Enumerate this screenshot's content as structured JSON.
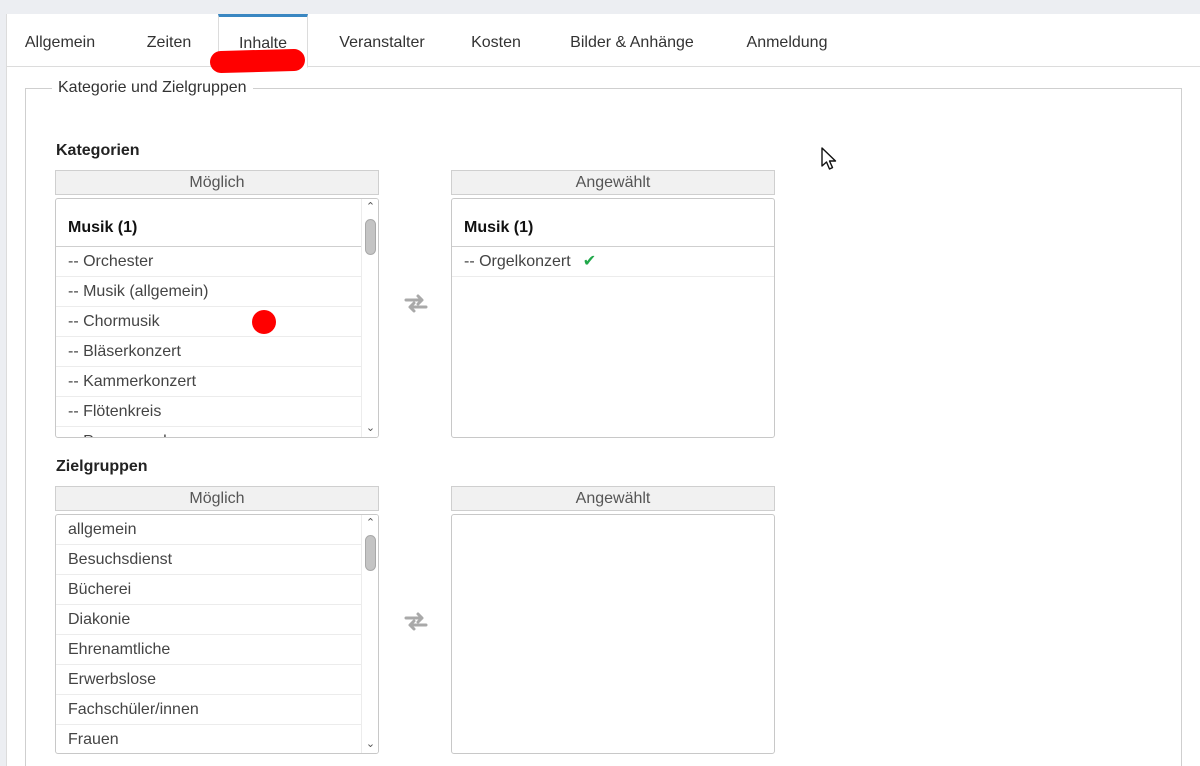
{
  "tabs": [
    {
      "label": "Allgemein"
    },
    {
      "label": "Zeiten"
    },
    {
      "label": "Inhalte"
    },
    {
      "label": "Veranstalter"
    },
    {
      "label": "Kosten"
    },
    {
      "label": "Bilder & Anhänge"
    },
    {
      "label": "Anmeldung"
    }
  ],
  "active_tab": "Inhalte",
  "fieldset": {
    "legend": "Kategorie und Zielgruppen"
  },
  "kategorien": {
    "title": "Kategorien",
    "possible_header": "Möglich",
    "selected_header": "Angewählt",
    "possible_group": "Musik (1)",
    "possible_items": [
      "-- Orchester",
      "-- Musik (allgemein)",
      "-- Chormusik",
      "-- Bläserkonzert",
      "-- Kammerkonzert",
      "-- Flötenkreis",
      "-- Posaunenchor"
    ],
    "selected_group": "Musik (1)",
    "selected_items": [
      "-- Orgelkonzert"
    ]
  },
  "zielgruppen": {
    "title": "Zielgruppen",
    "possible_header": "Möglich",
    "selected_header": "Angewählt",
    "possible_items": [
      "allgemein",
      "Besuchsdienst",
      "Bücherei",
      "Diakonie",
      "Ehrenamtliche",
      "Erwerbslose",
      "Fachschüler/innen",
      "Frauen"
    ],
    "selected_items": []
  },
  "icons": {
    "transfer": "transfer-arrows-icon",
    "check": "checkmark-icon",
    "scroll_up": "chevron-up-icon",
    "scroll_down": "chevron-down-icon",
    "cursor": "mouse-pointer-icon"
  },
  "colors": {
    "active_tab_accent": "#3a87c2",
    "check_green": "#21a84a",
    "annotation_red": "#ff0000"
  }
}
